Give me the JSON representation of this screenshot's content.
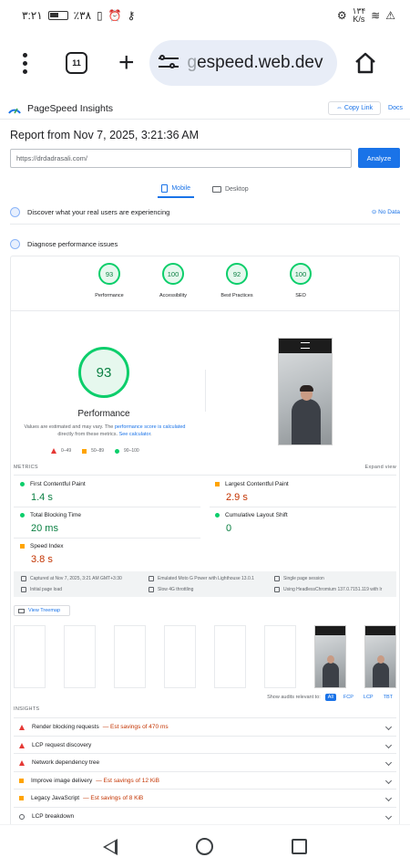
{
  "status_bar": {
    "time": "۳:۲۱",
    "battery_pct": "٪۳۸",
    "net_speed": "۱۳۴",
    "net_unit": "K/s"
  },
  "browser": {
    "tab_count": "11",
    "url_faded": "g",
    "url_text": "espeed.web.dev"
  },
  "psi": {
    "title": "PageSpeed Insights",
    "copy_link": "Copy Link",
    "docs": "Docs",
    "report_title": "Report from Nov 7, 2025, 3:21:36 AM",
    "url_value": "https://drdadrasali.com/",
    "analyze_label": "Analyze",
    "tabs": [
      {
        "label": "Mobile"
      },
      {
        "label": "Desktop"
      }
    ],
    "discover_text": "Discover what your real users are experiencing",
    "no_data": "No Data",
    "diagnose_text": "Diagnose performance issues"
  },
  "scores": [
    {
      "label": "Performance",
      "value": "93"
    },
    {
      "label": "Accessibility",
      "value": "100"
    },
    {
      "label": "Best Practices",
      "value": "92"
    },
    {
      "label": "SEO",
      "value": "100"
    }
  ],
  "performance": {
    "score": "93",
    "title": "Performance",
    "note_prefix": "Values are estimated and may vary. The ",
    "note_link": "performance score is calculated",
    "note_mid": " directly from these metrics. ",
    "note_link2": "See calculator",
    "note_end": ".",
    "legend": {
      "poor": "0–49",
      "average": "50–89",
      "good": "90–100"
    }
  },
  "metrics": {
    "heading": "METRICS",
    "expand": "Expand view",
    "items": [
      {
        "label": "First Contentful Paint",
        "value": "1.4 s",
        "status": "good"
      },
      {
        "label": "Largest Contentful Paint",
        "value": "2.9 s",
        "status": "average"
      },
      {
        "label": "Total Blocking Time",
        "value": "20 ms",
        "status": "good"
      },
      {
        "label": "Cumulative Layout Shift",
        "value": "0",
        "status": "good"
      },
      {
        "label": "Speed Index",
        "value": "3.8 s",
        "status": "average"
      }
    ]
  },
  "run_info": {
    "captured": "Captured at Nov 7, 2025, 3:21 AM GMT+3:30",
    "emulated": "Emulated Moto G Power with Lighthouse 13.0.1",
    "session": "Single page session",
    "initial_load": "Initial page load",
    "throttling": "Slow 4G throttling",
    "browser": "Using HeadlessChromium 137.0.7151.119 with lr"
  },
  "treemap_label": "View Treemap",
  "audits": {
    "label": "Show audits relevant to:",
    "chips": [
      "All",
      "FCP",
      "LCP",
      "TBT"
    ]
  },
  "insights": {
    "heading": "INSIGHTS",
    "items": [
      {
        "label": "Render blocking requests",
        "savings": "— Est savings of 470 ms",
        "severity": "fail"
      },
      {
        "label": "LCP request discovery",
        "savings": "",
        "severity": "fail"
      },
      {
        "label": "Network dependency tree",
        "savings": "",
        "severity": "fail"
      },
      {
        "label": "Improve image delivery",
        "savings": "— Est savings of 12 KiB",
        "severity": "average"
      },
      {
        "label": "Legacy JavaScript",
        "savings": "— Est savings of 8 KiB",
        "severity": "average"
      },
      {
        "label": "LCP breakdown",
        "savings": "",
        "severity": "info"
      }
    ]
  }
}
